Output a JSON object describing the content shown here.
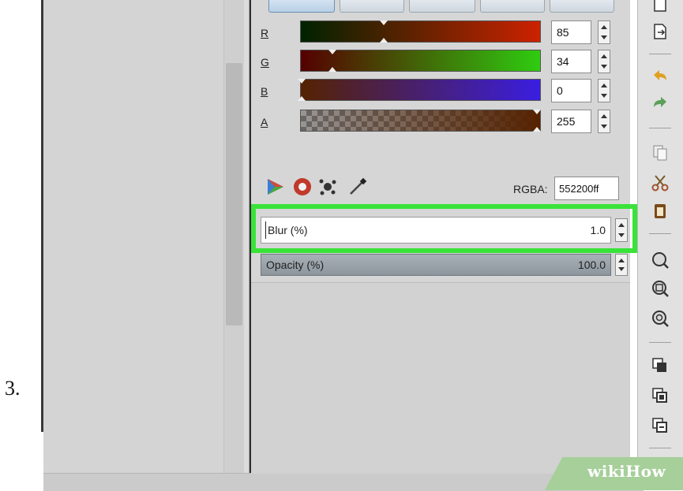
{
  "step_label": "3.",
  "color_channels": [
    {
      "label": "R",
      "value": "85"
    },
    {
      "label": "G",
      "value": "34"
    },
    {
      "label": "B",
      "value": "0"
    },
    {
      "label": "A",
      "value": "255"
    }
  ],
  "color_modes": [
    "rgb-triangle-icon",
    "wheel-icon",
    "splash-icon",
    "eyedropper-icon"
  ],
  "rgba": {
    "label": "RGBA:",
    "value": "552200ff"
  },
  "blur": {
    "label": "Blur (%)",
    "value": "1.0"
  },
  "opacity": {
    "label": "Opacity (%)",
    "value": "100.0"
  },
  "colors": {
    "highlight": "#39e339",
    "current_color": "#552200"
  },
  "toolbar_icons": [
    "export-icon",
    "undo-icon",
    "redo-icon",
    "copy-icon",
    "cut-icon",
    "paste-icon",
    "zoom-selection-icon",
    "zoom-drawing-icon",
    "zoom-page-icon",
    "duplicate-icon",
    "clone-icon",
    "unlink-clone-icon"
  ],
  "watermark": "wikiHow"
}
